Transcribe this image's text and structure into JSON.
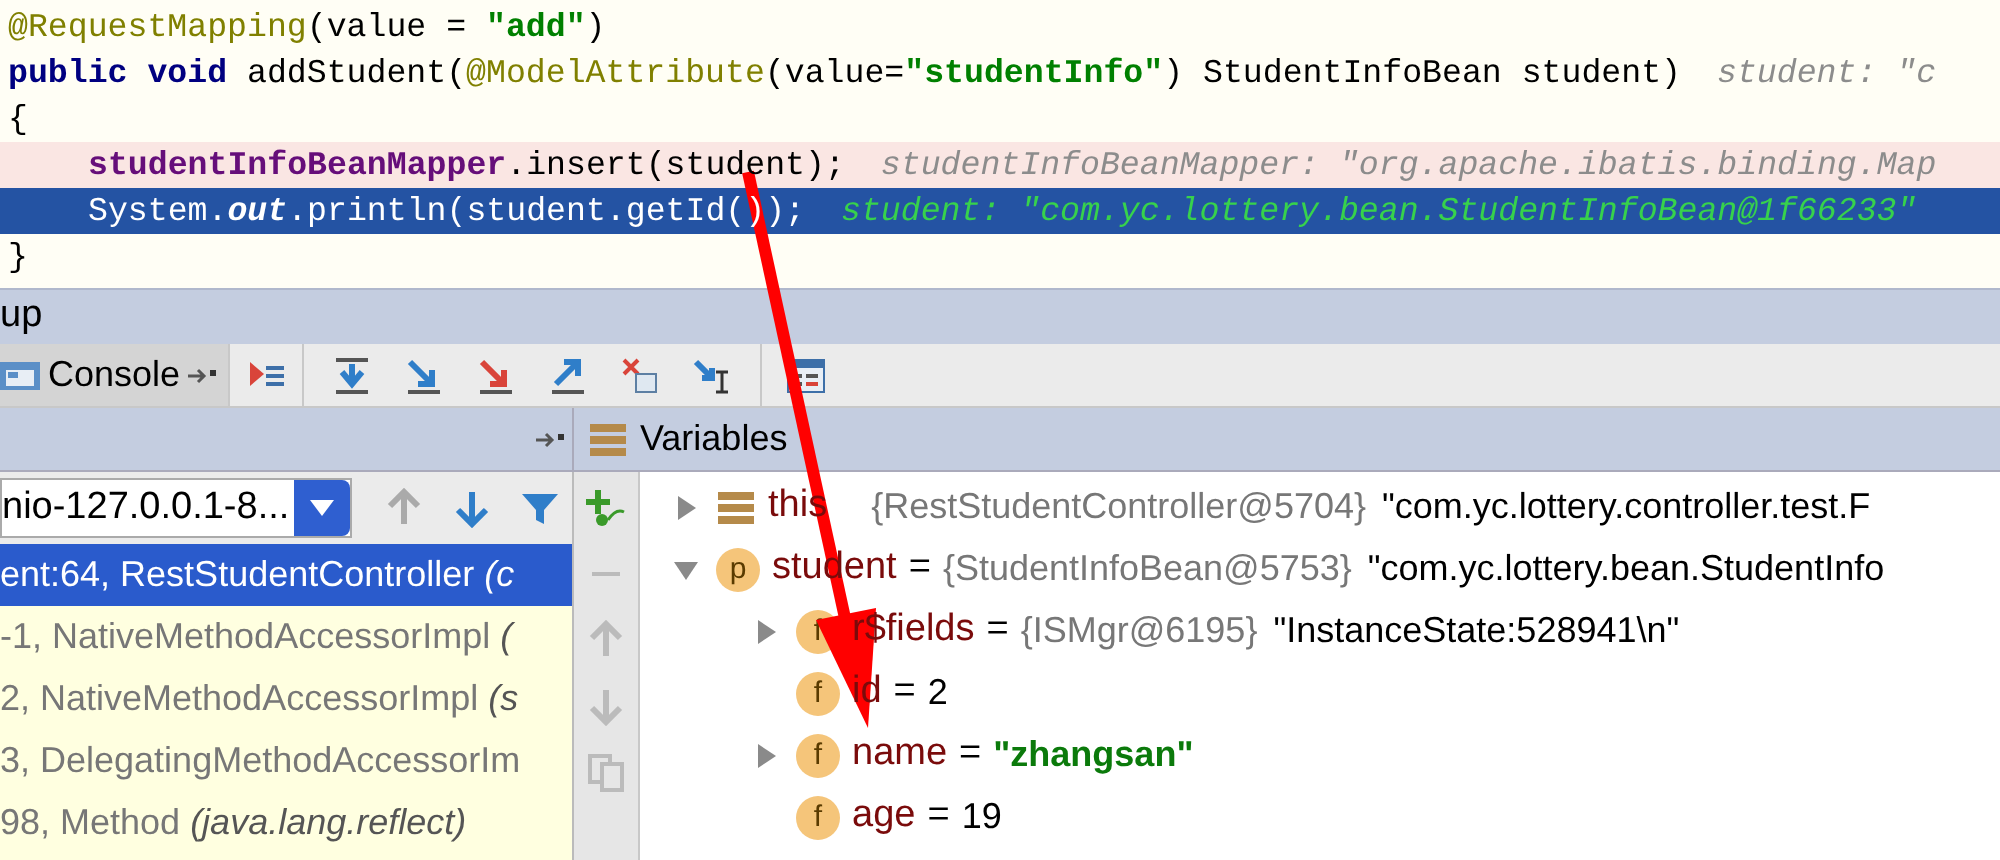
{
  "code": {
    "lines": [
      {
        "breakpoint": false,
        "selected": false,
        "indent": false,
        "tokens": [
          {
            "kind": "annotation",
            "text": "@RequestMapping"
          },
          {
            "kind": "plain",
            "text": "(value = "
          },
          {
            "kind": "string",
            "text": "\"add\""
          },
          {
            "kind": "plain",
            "text": ")"
          }
        ]
      },
      {
        "breakpoint": false,
        "selected": false,
        "indent": false,
        "tokens": [
          {
            "kind": "keyword",
            "text": "public void "
          },
          {
            "kind": "plain",
            "text": "addStudent("
          },
          {
            "kind": "annotation",
            "text": "@ModelAttribute"
          },
          {
            "kind": "plain",
            "text": "(value="
          },
          {
            "kind": "string",
            "text": "\"studentInfo\""
          },
          {
            "kind": "plain",
            "text": ") StudentInfoBean student)"
          },
          {
            "kind": "hint",
            "text": "student: \"c"
          }
        ]
      },
      {
        "breakpoint": false,
        "selected": false,
        "indent": false,
        "tokens": [
          {
            "kind": "plain",
            "text": "{"
          }
        ]
      },
      {
        "breakpoint": true,
        "selected": false,
        "indent": true,
        "tokens": [
          {
            "kind": "field",
            "text": "studentInfoBeanMapper"
          },
          {
            "kind": "plain",
            "text": ".insert(student);"
          },
          {
            "kind": "hint",
            "text": "studentInfoBeanMapper: \"org.apache.ibatis.binding.Map"
          }
        ]
      },
      {
        "breakpoint": false,
        "selected": true,
        "indent": true,
        "tokens": [
          {
            "kind": "plain",
            "text": "System."
          },
          {
            "kind": "static",
            "text": "out"
          },
          {
            "kind": "plain",
            "text": ".println(student.getId());"
          },
          {
            "kind": "hint",
            "text": "student: \"com.yc.lottery.bean.StudentInfoBean@1f66233\""
          }
        ]
      },
      {
        "breakpoint": false,
        "selected": false,
        "indent": false,
        "tokens": [
          {
            "kind": "plain",
            "text": "}"
          }
        ]
      }
    ]
  },
  "tool_window": {
    "title": "up"
  },
  "toolbar": {
    "tabs": [
      {
        "label": "Console",
        "selected": true
      }
    ]
  },
  "frames": {
    "thread": "nio-127.0.0.1-8...",
    "rows": [
      {
        "selected": true,
        "text": "ent:64, RestStudentController ",
        "italic": "(c"
      },
      {
        "selected": false,
        "text": "-1, NativeMethodAccessorImpl ",
        "italic": "("
      },
      {
        "selected": false,
        "text": "2, NativeMethodAccessorImpl ",
        "italic": "(s"
      },
      {
        "selected": false,
        "text": "3, DelegatingMethodAccessorIm"
      },
      {
        "selected": false,
        "text": "98, Method ",
        "italic": "(java.lang.reflect)"
      }
    ]
  },
  "variables": {
    "title": "Variables",
    "items": [
      {
        "kind": "object",
        "name": "this",
        "type": "{RestStudentController@5704}",
        "value": "\"com.yc.lottery.controller.test.F",
        "expanded": false
      },
      {
        "kind": "param",
        "badge": "p",
        "name": "student",
        "eq": "=",
        "type": "{StudentInfoBean@5753}",
        "value": "\"com.yc.lottery.bean.StudentInfo",
        "expanded": true,
        "children": [
          {
            "kind": "field",
            "badge": "f",
            "name": "r$fields",
            "eq": "=",
            "type": "{ISMgr@6195}",
            "value": "\"InstanceState:528941\\n\"",
            "expanded": false
          },
          {
            "kind": "field",
            "badge": "f",
            "name": "id",
            "eq": "=",
            "value": "2"
          },
          {
            "kind": "field",
            "badge": "f",
            "name": "name",
            "eq": "=",
            "value": "\"zhangsan\"",
            "string": true,
            "expanded": false
          },
          {
            "kind": "field",
            "badge": "f",
            "name": "age",
            "eq": "=",
            "value": "19",
            "string": false
          }
        ]
      }
    ]
  }
}
